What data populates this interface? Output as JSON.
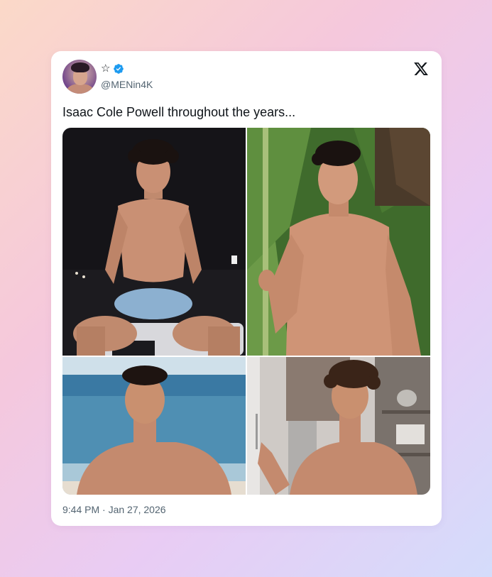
{
  "tweet": {
    "display_name": "☆",
    "handle": "@MENin4K",
    "text": "Isaac Cole Powell throughout the years...",
    "timestamp": "9:44 PM · Jan 27, 2026",
    "verified": true
  },
  "icons": {
    "avatar": "profile-avatar",
    "verified": "verified-badge-icon",
    "platform": "x-logo-icon"
  },
  "photos": [
    {
      "name": "photo-1",
      "scene": "night-seated"
    },
    {
      "name": "photo-2",
      "scene": "banana-leaves"
    },
    {
      "name": "photo-3",
      "scene": "beach"
    },
    {
      "name": "photo-4",
      "scene": "kitchen"
    }
  ],
  "colors": {
    "verified_blue": "#1d9bf0",
    "text_primary": "#0f1419",
    "text_secondary": "#536471"
  }
}
